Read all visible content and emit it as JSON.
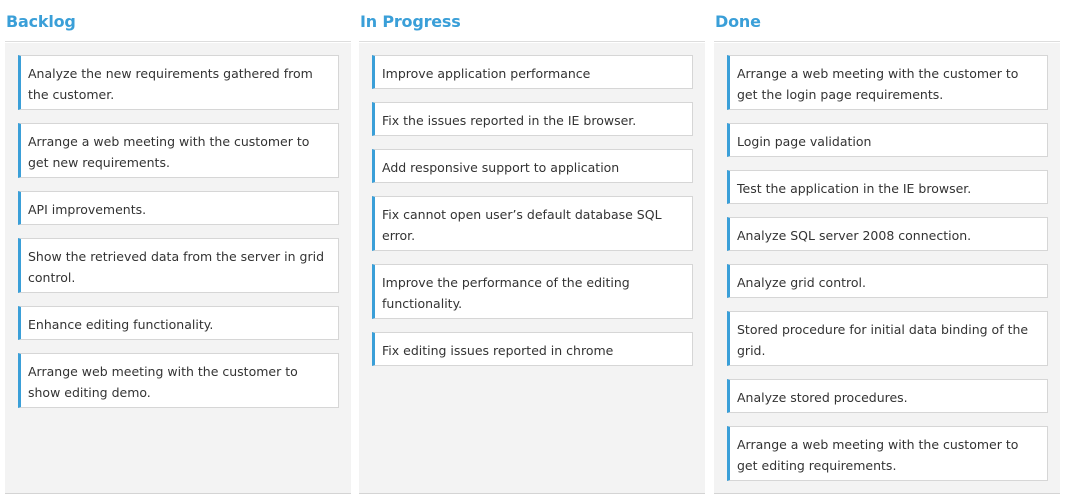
{
  "board": {
    "columns": [
      {
        "title": "Backlog",
        "cards": [
          "Analyze the new requirements gathered from the customer.",
          "Arrange a web meeting with the customer to get new requirements.",
          "API improvements.",
          "Show the retrieved data from the server in grid control.",
          "Enhance editing functionality.",
          "Arrange web meeting with the customer to show editing demo."
        ]
      },
      {
        "title": "In Progress",
        "cards": [
          "Improve application performance",
          "Fix the issues reported in the IE browser.",
          "Add responsive support to application",
          "Fix cannot open user’s default database SQL error.",
          "Improve the performance of the editing functionality.",
          "Fix editing issues reported in chrome"
        ]
      },
      {
        "title": "Done",
        "cards": [
          "Arrange a web meeting with the customer to get the login page requirements.",
          "Login page validation",
          "Test the application in the IE browser.",
          "Analyze SQL server 2008 connection.",
          "Analyze grid control.",
          "Stored procedure for initial data binding of the grid.",
          "Analyze stored procedures.",
          "Arrange a web meeting with the customer to get editing requirements."
        ]
      }
    ]
  },
  "colors": {
    "accent": "#3a9fd8",
    "column_background": "#f3f3f3",
    "card_border": "#d6d6d6",
    "text": "#333333"
  }
}
